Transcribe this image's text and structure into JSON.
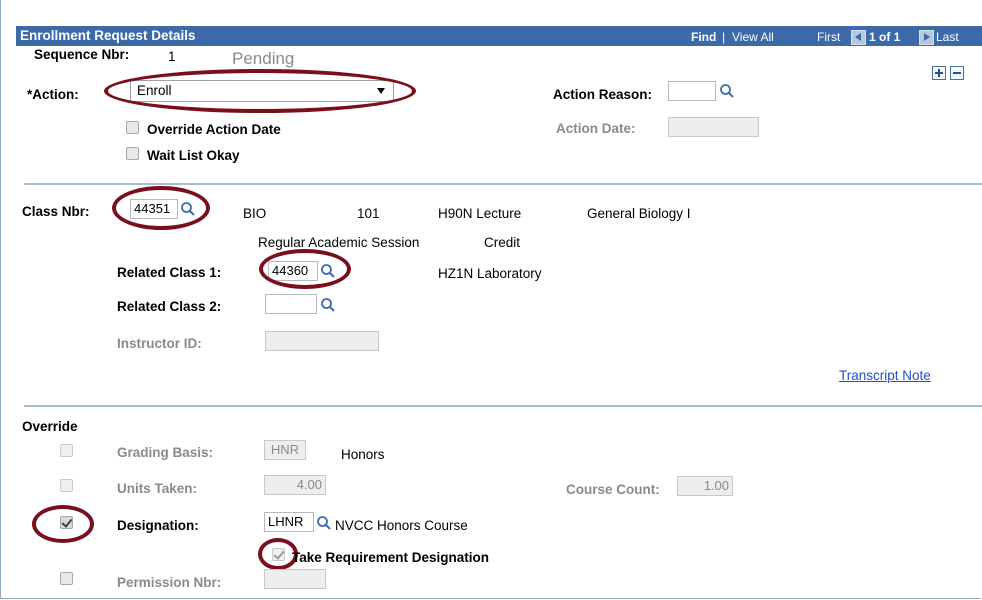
{
  "header": {
    "title": "Enrollment Request Details",
    "find": "Find",
    "sep": "|",
    "view_all": "View All",
    "first": "First",
    "count": "1 of 1",
    "last": "Last"
  },
  "request": {
    "sequence_label": "Sequence Nbr:",
    "sequence_value": "1",
    "status": "Pending",
    "action_label": "*Action:",
    "action_value": "Enroll",
    "action_reason_label": "Action Reason:",
    "action_reason_value": "",
    "override_action_date_label": "Override Action Date",
    "action_date_label": "Action Date:",
    "action_date_value": "",
    "wait_list_label": "Wait List Okay"
  },
  "class": {
    "class_nbr_label": "Class Nbr:",
    "class_nbr_value": "44351",
    "subject": "BIO",
    "catalog": "101",
    "section_component": "H90N Lecture",
    "course_title": "General Biology I",
    "session": "Regular Academic Session",
    "credit": "Credit",
    "related1_label": "Related Class 1:",
    "related1_value": "44360",
    "related1_desc": "HZ1N Laboratory",
    "related2_label": "Related Class 2:",
    "related2_value": "",
    "instructor_label": "Instructor ID:",
    "instructor_value": "",
    "transcript_note": "Transcript Note"
  },
  "override": {
    "section_label": "Override",
    "grading_label": "Grading Basis:",
    "grading_value": "HNR",
    "grading_desc": "Honors",
    "units_label": "Units Taken:",
    "units_value": "4.00",
    "course_count_label": "Course Count:",
    "course_count_value": "1.00",
    "designation_label": "Designation:",
    "designation_value": "LHNR",
    "designation_desc": "NVCC Honors Course",
    "take_req_label": "Take Requirement Designation",
    "permission_label": "Permission Nbr:",
    "permission_value": ""
  },
  "colors": {
    "header_bg": "#3c6aa8",
    "annotation": "#7a0f1c",
    "link": "#1f4ed1"
  }
}
